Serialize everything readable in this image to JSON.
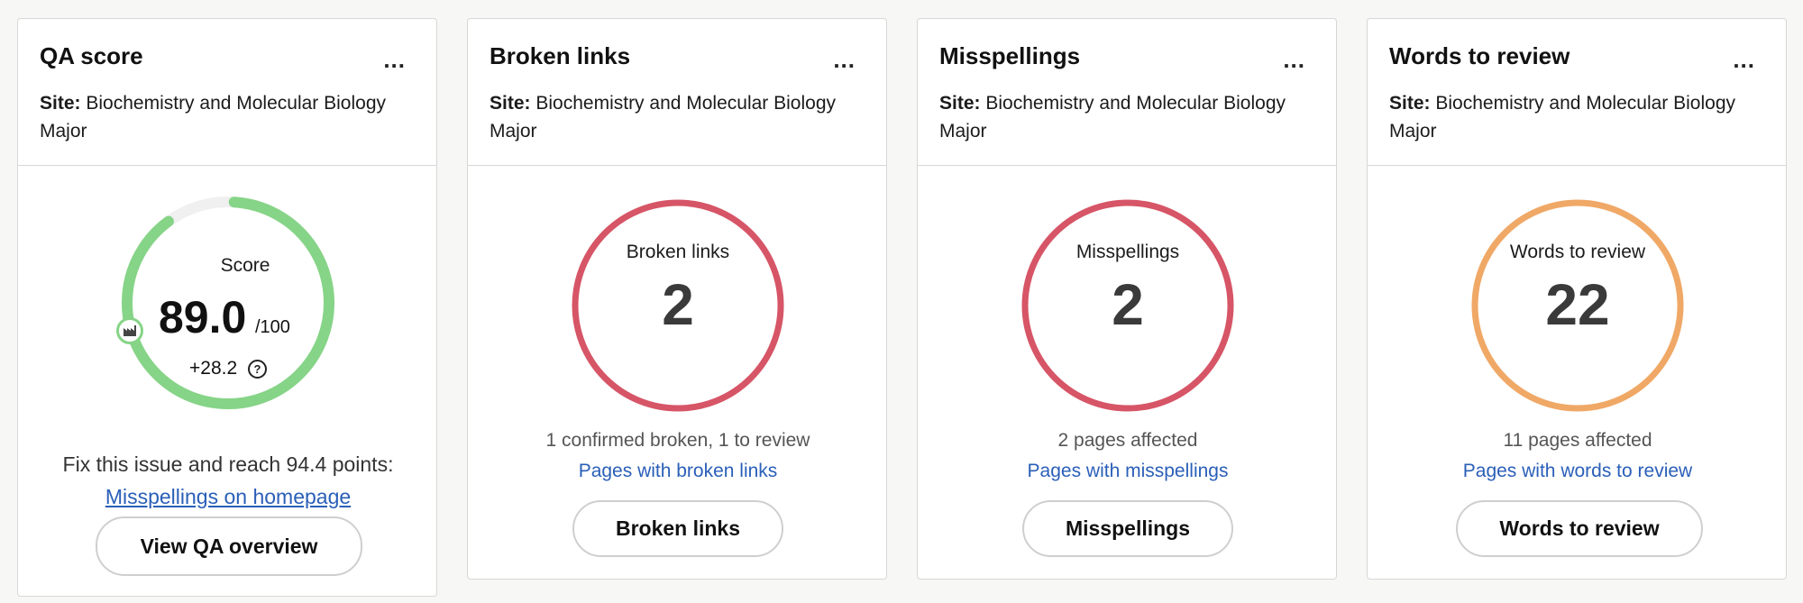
{
  "colors": {
    "green": "#86d487",
    "track": "#f0f0f0",
    "red": "#d65566",
    "orange": "#f0a866",
    "link": "#2a5fb8"
  },
  "site_label": "Site:",
  "site_name": "Biochemistry and Molecular Biology Major",
  "more_label": "...",
  "qa": {
    "title": "QA score",
    "score_label": "Score",
    "score": "89.0",
    "max": "/100",
    "score_fraction": 0.89,
    "delta": "+28.2",
    "help_icon": "question-circle-icon",
    "marker_icon": "factory-icon",
    "fix_text": "Fix this issue and reach 94.4 points:",
    "fix_link": "Misspellings on homepage",
    "button": "View QA overview"
  },
  "broken": {
    "title": "Broken links",
    "ring_label": "Broken links",
    "value": "2",
    "desc": "1 confirmed broken, 1 to review",
    "link": "Pages with broken links",
    "button": "Broken links"
  },
  "misspell": {
    "title": "Misspellings",
    "ring_label": "Misspellings",
    "value": "2",
    "desc": "2 pages affected",
    "link": "Pages with misspellings",
    "button": "Misspellings"
  },
  "words": {
    "title": "Words to review",
    "ring_label": "Words to review",
    "value": "22",
    "desc": "11 pages affected",
    "link": "Pages with words to review",
    "button": "Words to review"
  }
}
